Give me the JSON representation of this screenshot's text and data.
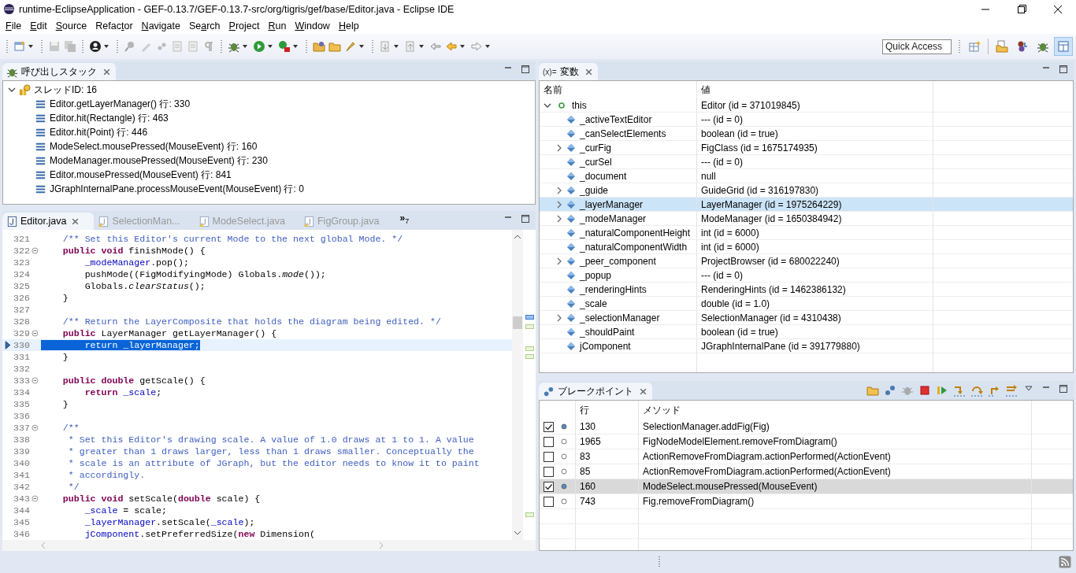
{
  "window": {
    "title": "runtime-EclipseApplication - GEF-0.13.7/GEF-0.13.7-src/org/tigris/gef/base/Editor.java - Eclipse IDE"
  },
  "menu": [
    {
      "key": "F",
      "rest": "ile"
    },
    {
      "key": "E",
      "rest": "dit"
    },
    {
      "key": "S",
      "rest": "ource"
    },
    {
      "pre": "Refac",
      "key": "t",
      "rest": "or"
    },
    {
      "key": "N",
      "rest": "avigate"
    },
    {
      "pre": "Se",
      "key": "a",
      "rest": "rch"
    },
    {
      "key": "P",
      "rest": "roject"
    },
    {
      "key": "R",
      "rest": "un"
    },
    {
      "key": "W",
      "rest": "indow"
    },
    {
      "key": "H",
      "rest": "elp"
    }
  ],
  "quick_access": {
    "placeholder": "Quick Access"
  },
  "perspectives": [
    {
      "selected": false
    },
    {
      "selected": false
    },
    {
      "selected": false
    },
    {
      "selected": false
    },
    {
      "selected": true
    }
  ],
  "call_stack": {
    "tab": "呼び出しスタック",
    "thread": {
      "label": "スレッドID: 16",
      "expanded": true,
      "children": [
        "Editor.getLayerManager() 行: 330",
        "Editor.hit(Rectangle) 行: 463",
        "Editor.hit(Point) 行: 446",
        "ModeSelect.mousePressed(MouseEvent) 行: 160",
        "ModeManager.mousePressed(MouseEvent) 行: 230",
        "Editor.mousePressed(MouseEvent) 行: 841",
        "JGraphInternalPane.processMouseEvent(MouseEvent) 行: 0"
      ]
    }
  },
  "editor": {
    "tabs": [
      {
        "label": "Editor.java",
        "selected": true
      },
      {
        "label": "SelectionMan...",
        "selected": false
      },
      {
        "label": "ModeSelect.java",
        "selected": false
      },
      {
        "label": "FigGroup.java",
        "selected": false
      }
    ],
    "overflow": {
      "symbol": "»",
      "count": "7"
    },
    "lines": [
      {
        "number": "321",
        "fold": false,
        "current": false,
        "segments": [
          {
            "text": "    /** Set this Editor's current Mode to the next global Mode. */",
            "kind": "comment"
          }
        ]
      },
      {
        "number": "322",
        "fold": true,
        "current": false,
        "segments": [
          {
            "text": "    public void",
            "kind": "kw"
          },
          {
            "text": " finishMode() {",
            "kind": "plain"
          }
        ]
      },
      {
        "number": "323",
        "fold": false,
        "current": false,
        "segments": [
          {
            "text": "        _modeManager",
            "kind": "field"
          },
          {
            "text": ".pop();",
            "kind": "plain"
          }
        ]
      },
      {
        "number": "324",
        "fold": false,
        "current": false,
        "segments": [
          {
            "text": "        pushMode((FigModifyingMode) Globals.",
            "kind": "plain"
          },
          {
            "text": "mode",
            "kind": "static"
          },
          {
            "text": "());",
            "kind": "plain"
          }
        ]
      },
      {
        "number": "325",
        "fold": false,
        "current": false,
        "segments": [
          {
            "text": "        Globals.",
            "kind": "plain"
          },
          {
            "text": "clearStatus",
            "kind": "static"
          },
          {
            "text": "();",
            "kind": "plain"
          }
        ]
      },
      {
        "number": "326",
        "fold": false,
        "current": false,
        "segments": [
          {
            "text": "    }",
            "kind": "plain"
          }
        ]
      },
      {
        "number": "327",
        "fold": false,
        "current": false
      },
      {
        "number": "328",
        "fold": false,
        "current": false,
        "segments": [
          {
            "text": "    /** Return the LayerComposite that holds the diagram being edited. */",
            "kind": "comment"
          }
        ]
      },
      {
        "number": "329",
        "fold": true,
        "current": false,
        "segments": [
          {
            "text": "    public",
            "kind": "kw"
          },
          {
            "text": " LayerManager getLayerManager() {",
            "kind": "plain"
          }
        ]
      },
      {
        "number": "330",
        "fold": false,
        "current": true,
        "segments": [
          {
            "text": "        return _layerManager;",
            "kind": "selection"
          }
        ]
      },
      {
        "number": "331",
        "fold": false,
        "current": false,
        "segments": [
          {
            "text": "    }",
            "kind": "plain"
          }
        ]
      },
      {
        "number": "332",
        "fold": false,
        "current": false
      },
      {
        "number": "333",
        "fold": true,
        "current": false,
        "segments": [
          {
            "text": "    public double",
            "kind": "kw"
          },
          {
            "text": " getScale() {",
            "kind": "plain"
          }
        ]
      },
      {
        "number": "334",
        "fold": false,
        "current": false,
        "segments": [
          {
            "text": "        return ",
            "kind": "kw"
          },
          {
            "text": "_scale",
            "kind": "field"
          },
          {
            "text": ";",
            "kind": "plain"
          }
        ]
      },
      {
        "number": "335",
        "fold": false,
        "current": false,
        "segments": [
          {
            "text": "    }",
            "kind": "plain"
          }
        ]
      },
      {
        "number": "336",
        "fold": false,
        "current": false
      },
      {
        "number": "337",
        "fold": true,
        "current": false,
        "segments": [
          {
            "text": "    /**",
            "kind": "comment"
          }
        ]
      },
      {
        "number": "338",
        "fold": false,
        "current": false,
        "segments": [
          {
            "text": "     * Set this Editor's drawing scale. A value of 1.0 draws at 1 to 1. A value",
            "kind": "comment"
          }
        ]
      },
      {
        "number": "339",
        "fold": false,
        "current": false,
        "segments": [
          {
            "text": "     * greater than 1 draws larger, less than 1 draws smaller. Conceptually the",
            "kind": "comment"
          }
        ]
      },
      {
        "number": "340",
        "fold": false,
        "current": false,
        "segments": [
          {
            "text": "     * scale is an attribute of JGraph, but the editor needs to know it to paint",
            "kind": "comment"
          }
        ]
      },
      {
        "number": "341",
        "fold": false,
        "current": false,
        "segments": [
          {
            "text": "     * accordingly.",
            "kind": "comment"
          }
        ]
      },
      {
        "number": "342",
        "fold": false,
        "current": false,
        "segments": [
          {
            "text": "     */",
            "kind": "comment"
          }
        ]
      },
      {
        "number": "343",
        "fold": true,
        "current": false,
        "segments": [
          {
            "text": "    public void",
            "kind": "kw"
          },
          {
            "text": " setScale(",
            "kind": "plain"
          },
          {
            "text": "double",
            "kind": "kw"
          },
          {
            "text": " scale) {",
            "kind": "plain"
          }
        ]
      },
      {
        "number": "344",
        "fold": false,
        "current": false,
        "segments": [
          {
            "text": "        _scale",
            "kind": "field"
          },
          {
            "text": " = scale;",
            "kind": "plain"
          }
        ]
      },
      {
        "number": "345",
        "fold": false,
        "current": false,
        "segments": [
          {
            "text": "        _layerManager",
            "kind": "field"
          },
          {
            "text": ".setScale(",
            "kind": "plain"
          },
          {
            "text": "_scale",
            "kind": "field"
          },
          {
            "text": ");",
            "kind": "plain"
          }
        ]
      },
      {
        "number": "346",
        "fold": false,
        "current": false,
        "segments": [
          {
            "text": "        jComponent",
            "kind": "field"
          },
          {
            "text": ".setPreferredSize(",
            "kind": "plain"
          },
          {
            "text": "new",
            "kind": "kw"
          },
          {
            "text": " Dimension(",
            "kind": "plain"
          }
        ]
      }
    ]
  },
  "variables": {
    "tab_icon_text": "(x)=",
    "tab": "変数",
    "columns": [
      "名前",
      "値"
    ],
    "root": {
      "name": "this",
      "value": "Editor (id = 371019845)",
      "expanded": true,
      "selected": false,
      "children": [
        {
          "name": "_activeTextEditor",
          "value": "--- (id = 0)",
          "kind": "field",
          "selected": false
        },
        {
          "name": "_canSelectElements",
          "value": "boolean (id = true)",
          "kind": "field",
          "selected": false
        },
        {
          "name": "_curFig",
          "value": "FigClass (id = 1675174935)",
          "kind": "object",
          "selected": false
        },
        {
          "name": "_curSel",
          "value": "--- (id = 0)",
          "kind": "field",
          "selected": false
        },
        {
          "name": "_document",
          "value": "null",
          "kind": "field",
          "selected": false
        },
        {
          "name": "_guide",
          "value": "GuideGrid (id = 316197830)",
          "kind": "object",
          "selected": false
        },
        {
          "name": "_layerManager",
          "value": "LayerManager (id = 1975264229)",
          "kind": "object",
          "selected": true
        },
        {
          "name": "_modeManager",
          "value": "ModeManager (id = 1650384942)",
          "kind": "object",
          "selected": false
        },
        {
          "name": "_naturalComponentHeight",
          "value": "int (id = 6000)",
          "kind": "field",
          "selected": false
        },
        {
          "name": "_naturalComponentWidth",
          "value": "int (id = 6000)",
          "kind": "field",
          "selected": false
        },
        {
          "name": "_peer_component",
          "value": "ProjectBrowser (id = 680022240)",
          "kind": "object",
          "selected": false
        },
        {
          "name": "_popup",
          "value": "--- (id = 0)",
          "kind": "field",
          "selected": false
        },
        {
          "name": "_renderingHints",
          "value": "RenderingHints (id = 1462386132)",
          "kind": "field",
          "selected": false
        },
        {
          "name": "_scale",
          "value": "double (id = 1.0)",
          "kind": "field",
          "selected": false
        },
        {
          "name": "_selectionManager",
          "value": "SelectionManager (id = 4310438)",
          "kind": "object",
          "selected": false
        },
        {
          "name": "_shouldPaint",
          "value": "boolean (id = true)",
          "kind": "field",
          "selected": false
        },
        {
          "name": "jComponent",
          "value": "JGraphInternalPane (id = 391779880)",
          "kind": "field",
          "selected": false
        }
      ]
    }
  },
  "breakpoints": {
    "tab": "ブレークポイント",
    "columns": [
      "行",
      "メソッド"
    ],
    "rows": [
      {
        "checked": true,
        "line": "130",
        "method": "SelectionManager.addFig(Fig)",
        "selected": false
      },
      {
        "checked": false,
        "line": "1965",
        "method": "FigNodeModelElement.removeFromDiagram()",
        "selected": false
      },
      {
        "checked": false,
        "line": "83",
        "method": "ActionRemoveFromDiagram.actionPerformed(ActionEvent)",
        "selected": false
      },
      {
        "checked": false,
        "line": "85",
        "method": "ActionRemoveFromDiagram.actionPerformed(ActionEvent)",
        "selected": false
      },
      {
        "checked": true,
        "line": "160",
        "method": "ModeSelect.mousePressed(MouseEvent)",
        "selected": true
      },
      {
        "checked": false,
        "line": "743",
        "method": "Fig.removeFromDiagram()",
        "selected": false
      }
    ]
  }
}
